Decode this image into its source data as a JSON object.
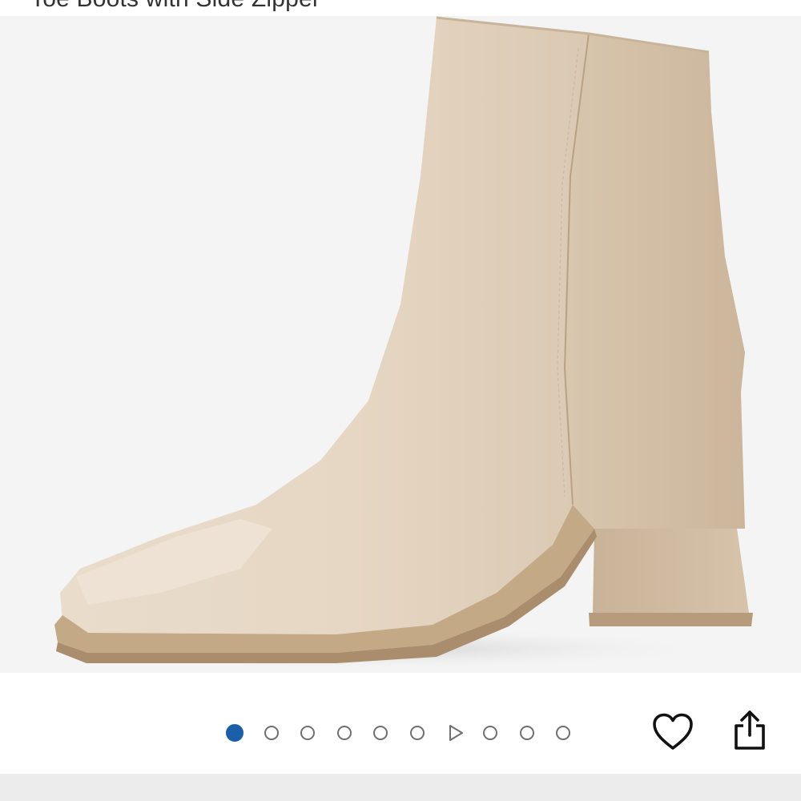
{
  "header": {
    "title_partial": "Toe Boots with Side Zipper"
  },
  "gallery": {
    "image_alt": "Beige square toe block heel ankle boot with side zipper",
    "current_index": 1,
    "total_items": 10,
    "video_index": 7,
    "active_color": "#1a5fa8"
  },
  "actions": {
    "favorite_icon": "heart-outline-icon",
    "share_icon": "share-icon"
  }
}
